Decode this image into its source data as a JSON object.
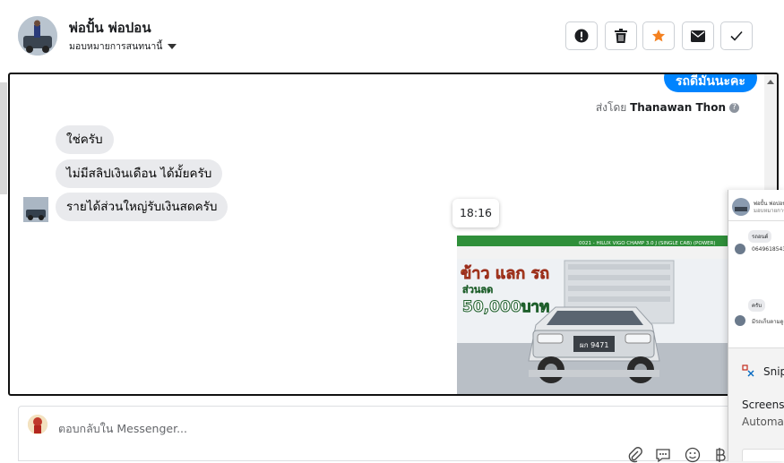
{
  "header": {
    "name": "พ่อปั้น พ่อปอน",
    "subtitle": "มอบหมายการสนทนานี้"
  },
  "conversation": {
    "outgoing_text": "รถดีมันนะคะ",
    "sent_by_prefix": "ส่งโดย",
    "sent_by_name": "Thanawan Thon",
    "help_glyph": "?",
    "incoming": [
      "ใช่ครับ",
      "ไม่มีสลิปเงินเดือน ได้มั้ยครับ",
      "รายได้ส่วนใหญ่รับเงินสดครับ"
    ],
    "timestamp": "18:16",
    "ad": {
      "banner_top": "ข้าว แลก รถ",
      "banner_mid": "ส่วนลด",
      "banner_big": "50,000บาท",
      "model_text": "0021 - HILUX VIGO CHAMP 3.0 J (SINGLE CAB) (POWER)",
      "plate": "ผก 9471"
    }
  },
  "composer": {
    "placeholder": "ตอบกลับใน Messenger..."
  },
  "overlay": {
    "name": "พ่อปั้น พ่อปอน",
    "subtitle": "มอบหมายการสนทนา",
    "msg1": "รถอนด์",
    "msg2": "0649618543",
    "msg3": "ครับ",
    "msg4": "มีรถเก็บตามดูแล",
    "snip_label": "Snip",
    "screens_label": "Screens",
    "automa_label": "Automa"
  },
  "colors": {
    "messenger_blue": "#0084ff",
    "star_orange": "#f48120"
  }
}
